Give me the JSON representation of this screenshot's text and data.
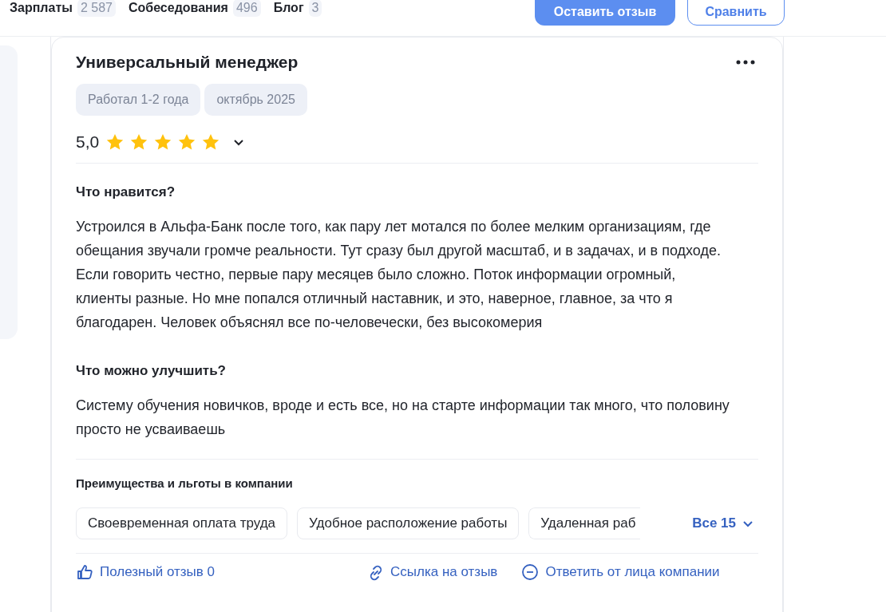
{
  "tabs": [
    {
      "label": "Зарплаты",
      "count": "2 587"
    },
    {
      "label": "Собеседования",
      "count": "496"
    },
    {
      "label": "Блог",
      "count": "3"
    }
  ],
  "actions": {
    "primary": "Оставить отзыв",
    "secondary": "Сравнить"
  },
  "review": {
    "title": "Универсальный менеджер",
    "tags": [
      "Работал 1-2 года",
      "октябрь 2025"
    ],
    "rating": "5,0",
    "stars": 5,
    "sections": [
      {
        "heading": "Что нравится?",
        "text": "Устроился в Альфа-Банк после того, как пару лет мотался по более мелким организациям, где обещания звучали громче реальности. Тут сразу был другой масштаб, и в задачах, и в подходе. Если говорить честно, первые пару месяцев было сложно. Поток информации огромный, клиенты разные. Но мне попался отличный наставник, и это, наверное, главное, за что я благодарен. Человек объяснял все по-человечески, без высокомерия"
      },
      {
        "heading": "Что можно улучшить?",
        "text": "Систему обучения новичков, вроде и есть все, но на старте информации так много, что половину просто не усваиваешь"
      }
    ],
    "benefits": {
      "heading": "Преимущества и льготы в компании",
      "items": [
        "Своевременная оплата труда",
        "Удобное расположение работы",
        "Удаленная раб"
      ],
      "more": "Все 15"
    },
    "footer": [
      "Полезный отзыв 0",
      "Ссылка на отзыв",
      "Ответить от лица компании"
    ]
  }
}
